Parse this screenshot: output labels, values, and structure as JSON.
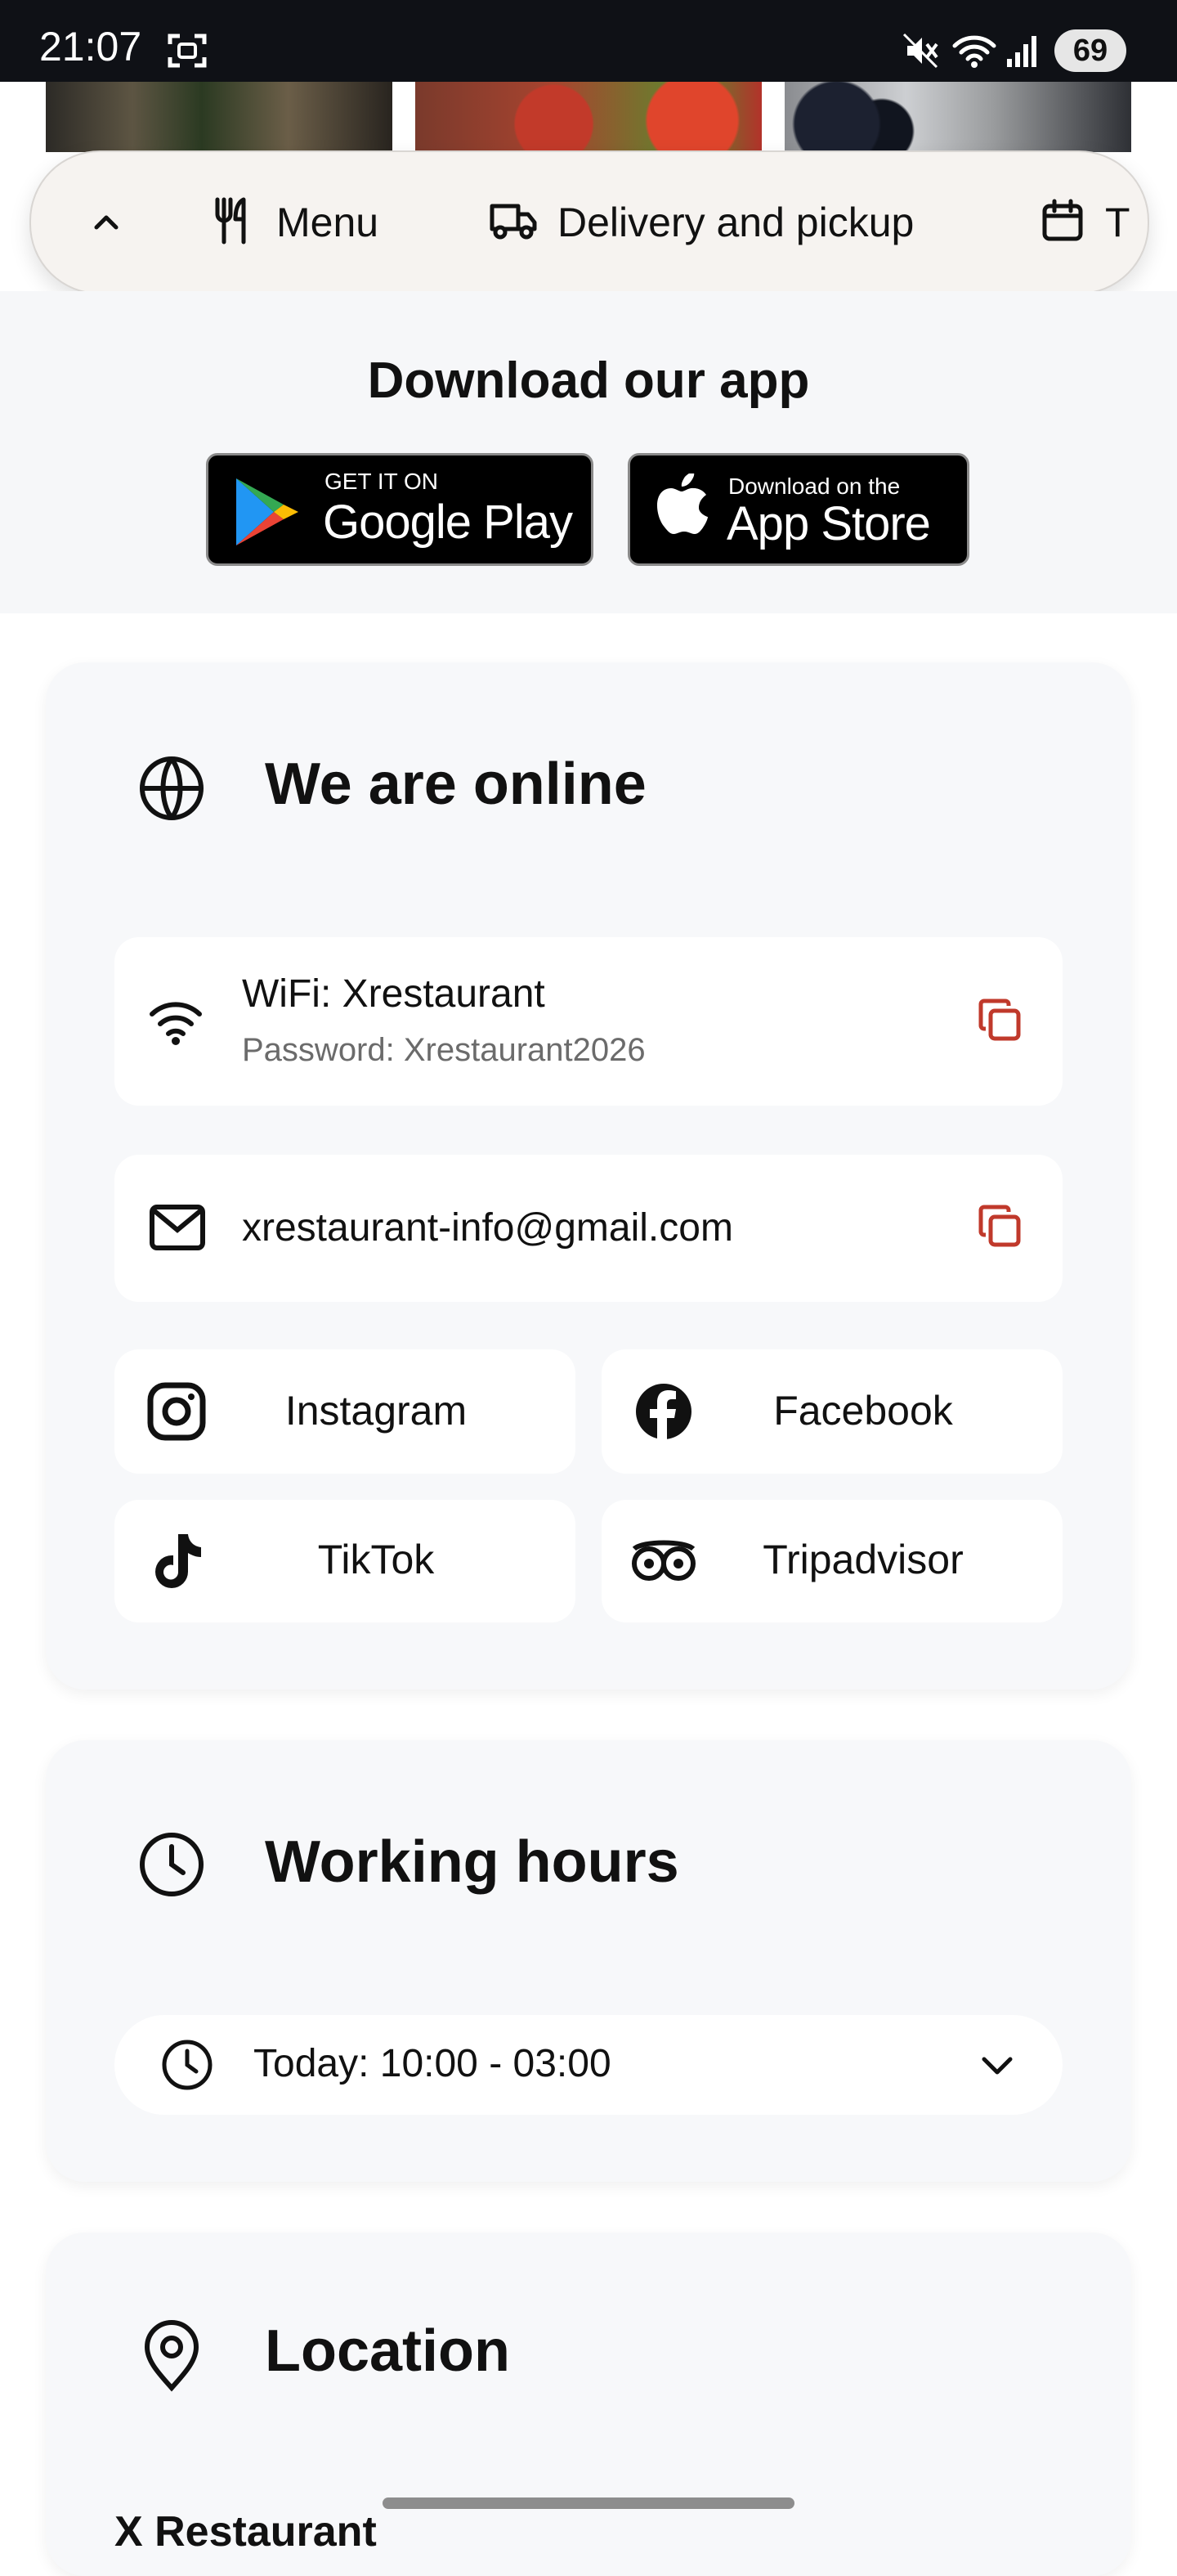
{
  "status_bar": {
    "time": "21:07",
    "battery": "69"
  },
  "nav": {
    "items": [
      {
        "label": "Menu",
        "icon": "fork-knife-icon"
      },
      {
        "label": "Delivery and pickup",
        "icon": "truck-icon"
      },
      {
        "label": "T",
        "icon": "calendar-icon"
      }
    ]
  },
  "download_app": {
    "title": "Download our app",
    "google_play": {
      "small": "GET IT ON",
      "big": "Google Play"
    },
    "app_store": {
      "small": "Download on the",
      "big": "App Store"
    }
  },
  "online": {
    "title": "We are online",
    "wifi": {
      "name": "WiFi: Xrestaurant",
      "password": "Password: Xrestaurant2026"
    },
    "email": "xrestaurant-info@gmail.com",
    "socials": [
      "Instagram",
      "Facebook",
      "TikTok",
      "Tripadvisor"
    ]
  },
  "hours": {
    "title": "Working hours",
    "today": "Today: 10:00 - 03:00"
  },
  "location": {
    "title": "Location",
    "partial_text": "X Restaurant"
  },
  "colors": {
    "accent": "#c0392b",
    "card_bg": "#f7f8fa",
    "section_bg": "#f6f7f9"
  }
}
